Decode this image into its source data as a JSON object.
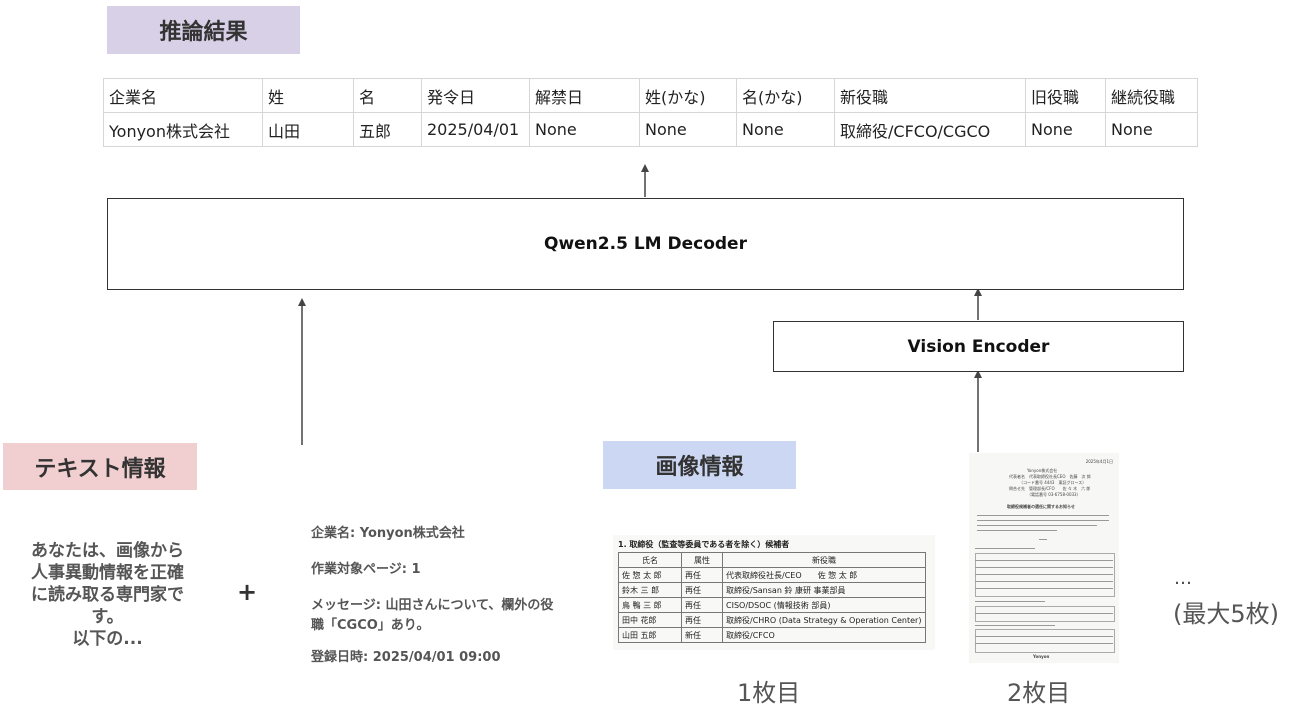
{
  "labels": {
    "result": "推論結果",
    "text_info": "テキスト情報",
    "image_info": "画像情報"
  },
  "result_table": {
    "headers": [
      "企業名",
      "姓",
      "名",
      "発令日",
      "解禁日",
      "姓(かな)",
      "名(かな)",
      "新役職",
      "旧役職",
      "継続役職"
    ],
    "row": [
      "Yonyon株式会社",
      "山田",
      "五郎",
      "2025/04/01",
      "None",
      "None",
      "None",
      "取締役/CFCO/CGCO",
      "None",
      "None"
    ]
  },
  "decoder": "Qwen2.5 LM Decoder",
  "vision_encoder": "Vision Encoder",
  "text_prompt": [
    "あなたは、画像から",
    "人事異動情報を正確",
    "に読み取る専門家で",
    "す。",
    "以下の..."
  ],
  "plus": "+",
  "metadata": {
    "company": "企業名: Yonyon株式会社",
    "page": "作業対象ページ: 1",
    "message": "メッセージ: 山田さんについて、欄外の役職「CGCO」あり。",
    "registered": "登録日時: 2025/04/01 09:00"
  },
  "doc1": {
    "title": "1. 取締役（監査等委員である者を除く）候補者",
    "headers": [
      "氏名",
      "属性",
      "新役職"
    ],
    "rows": [
      [
        "佐 惣 太 郎",
        "再任",
        "代表取締役社長/CEO　　佐 惣 太 郎"
      ],
      [
        "鈴木 三 郎",
        "再任",
        "取締役/Sansan 鈴 康研 事業部員"
      ],
      [
        "鳥 鴨 三 郎",
        "再任",
        "CISO/DSOC (情報技術 部員)"
      ],
      [
        "田中 花郎",
        "再任",
        "取締役/CHRO (Data Strategy & Operation Center)"
      ],
      [
        "山田 五郎",
        "新任",
        "取締役/CFCO"
      ]
    ]
  },
  "doc2": {
    "date": "2025年4月1日",
    "company": "Yonyon株式会社",
    "sender": "代表者名　代表取締役社長CEO　佐藤　次 郎",
    "code": "（コード番号 4443　東証グロース）",
    "contact": "問合せ先　管理部長/CFO　　佐 々 木　六 郎",
    "phone": "（電話番号 03-6758-0033）",
    "heading": "取締役候補者の選任に関するお知らせ",
    "footer": "Yonyon"
  },
  "captions": [
    "1枚目",
    "2枚目"
  ],
  "ellipsis": "…",
  "max_label": "(最大5枚)"
}
